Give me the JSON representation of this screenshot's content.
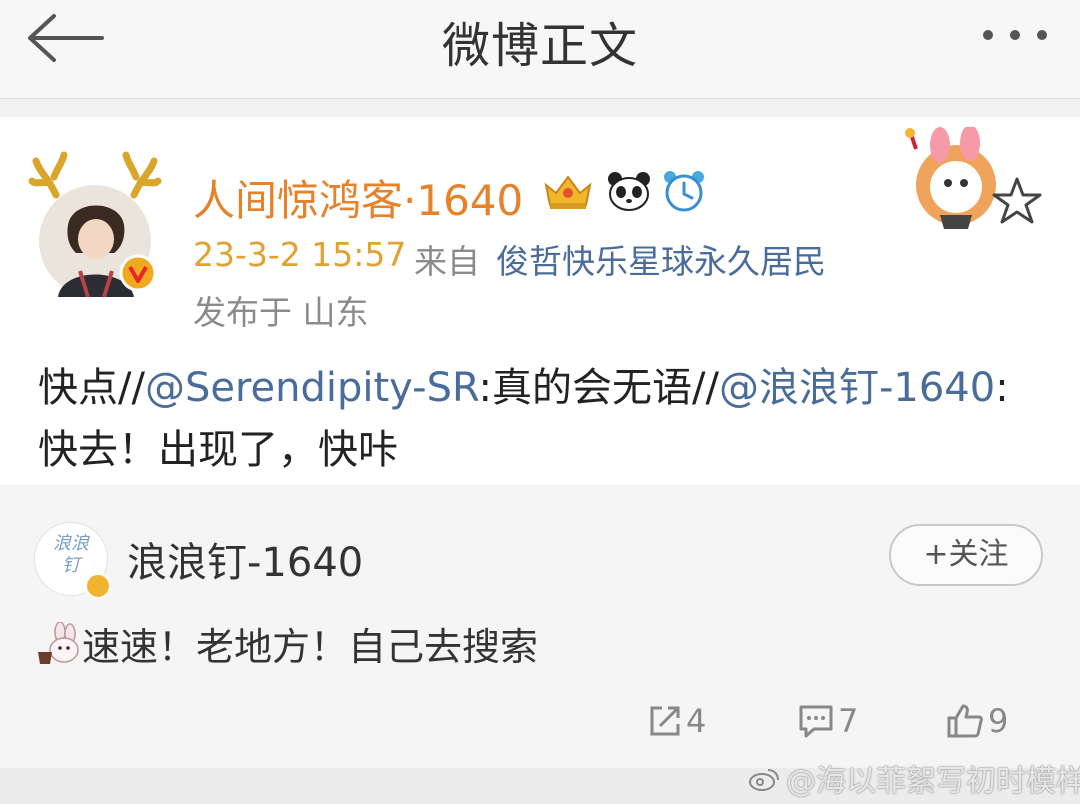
{
  "nav": {
    "title": "微博正文",
    "back_icon": "back-arrow-icon",
    "more_icon": "more-dots-icon"
  },
  "post": {
    "username": "人间惊鸿客·1640",
    "badges": [
      "crown-icon",
      "panda-icon",
      "alarm-clock-icon"
    ],
    "time": "23-3-2 15:57",
    "from_label": "来自",
    "source": "俊哲快乐星球永久居民",
    "location": "发布于 山东",
    "body": {
      "p1": "快点//",
      "m1": "@Serendipity-SR",
      "p2": ":真的会无语//",
      "m2": "@浪浪钉-1640",
      "p3": ":快去！出现了，快咔"
    },
    "colors": {
      "username": "#e5822a",
      "time": "#e2a230",
      "link": "#4a6c9b"
    }
  },
  "repost": {
    "avatar_text": "浪浪钉",
    "name": "浪浪钉-1640",
    "follow_label": "+关注",
    "text": "速速！老地方！自己去搜索",
    "actions": {
      "share_count": "4",
      "comment_count": "7",
      "like_count": "9"
    }
  },
  "watermark": "@海以菲絮写初时模样"
}
